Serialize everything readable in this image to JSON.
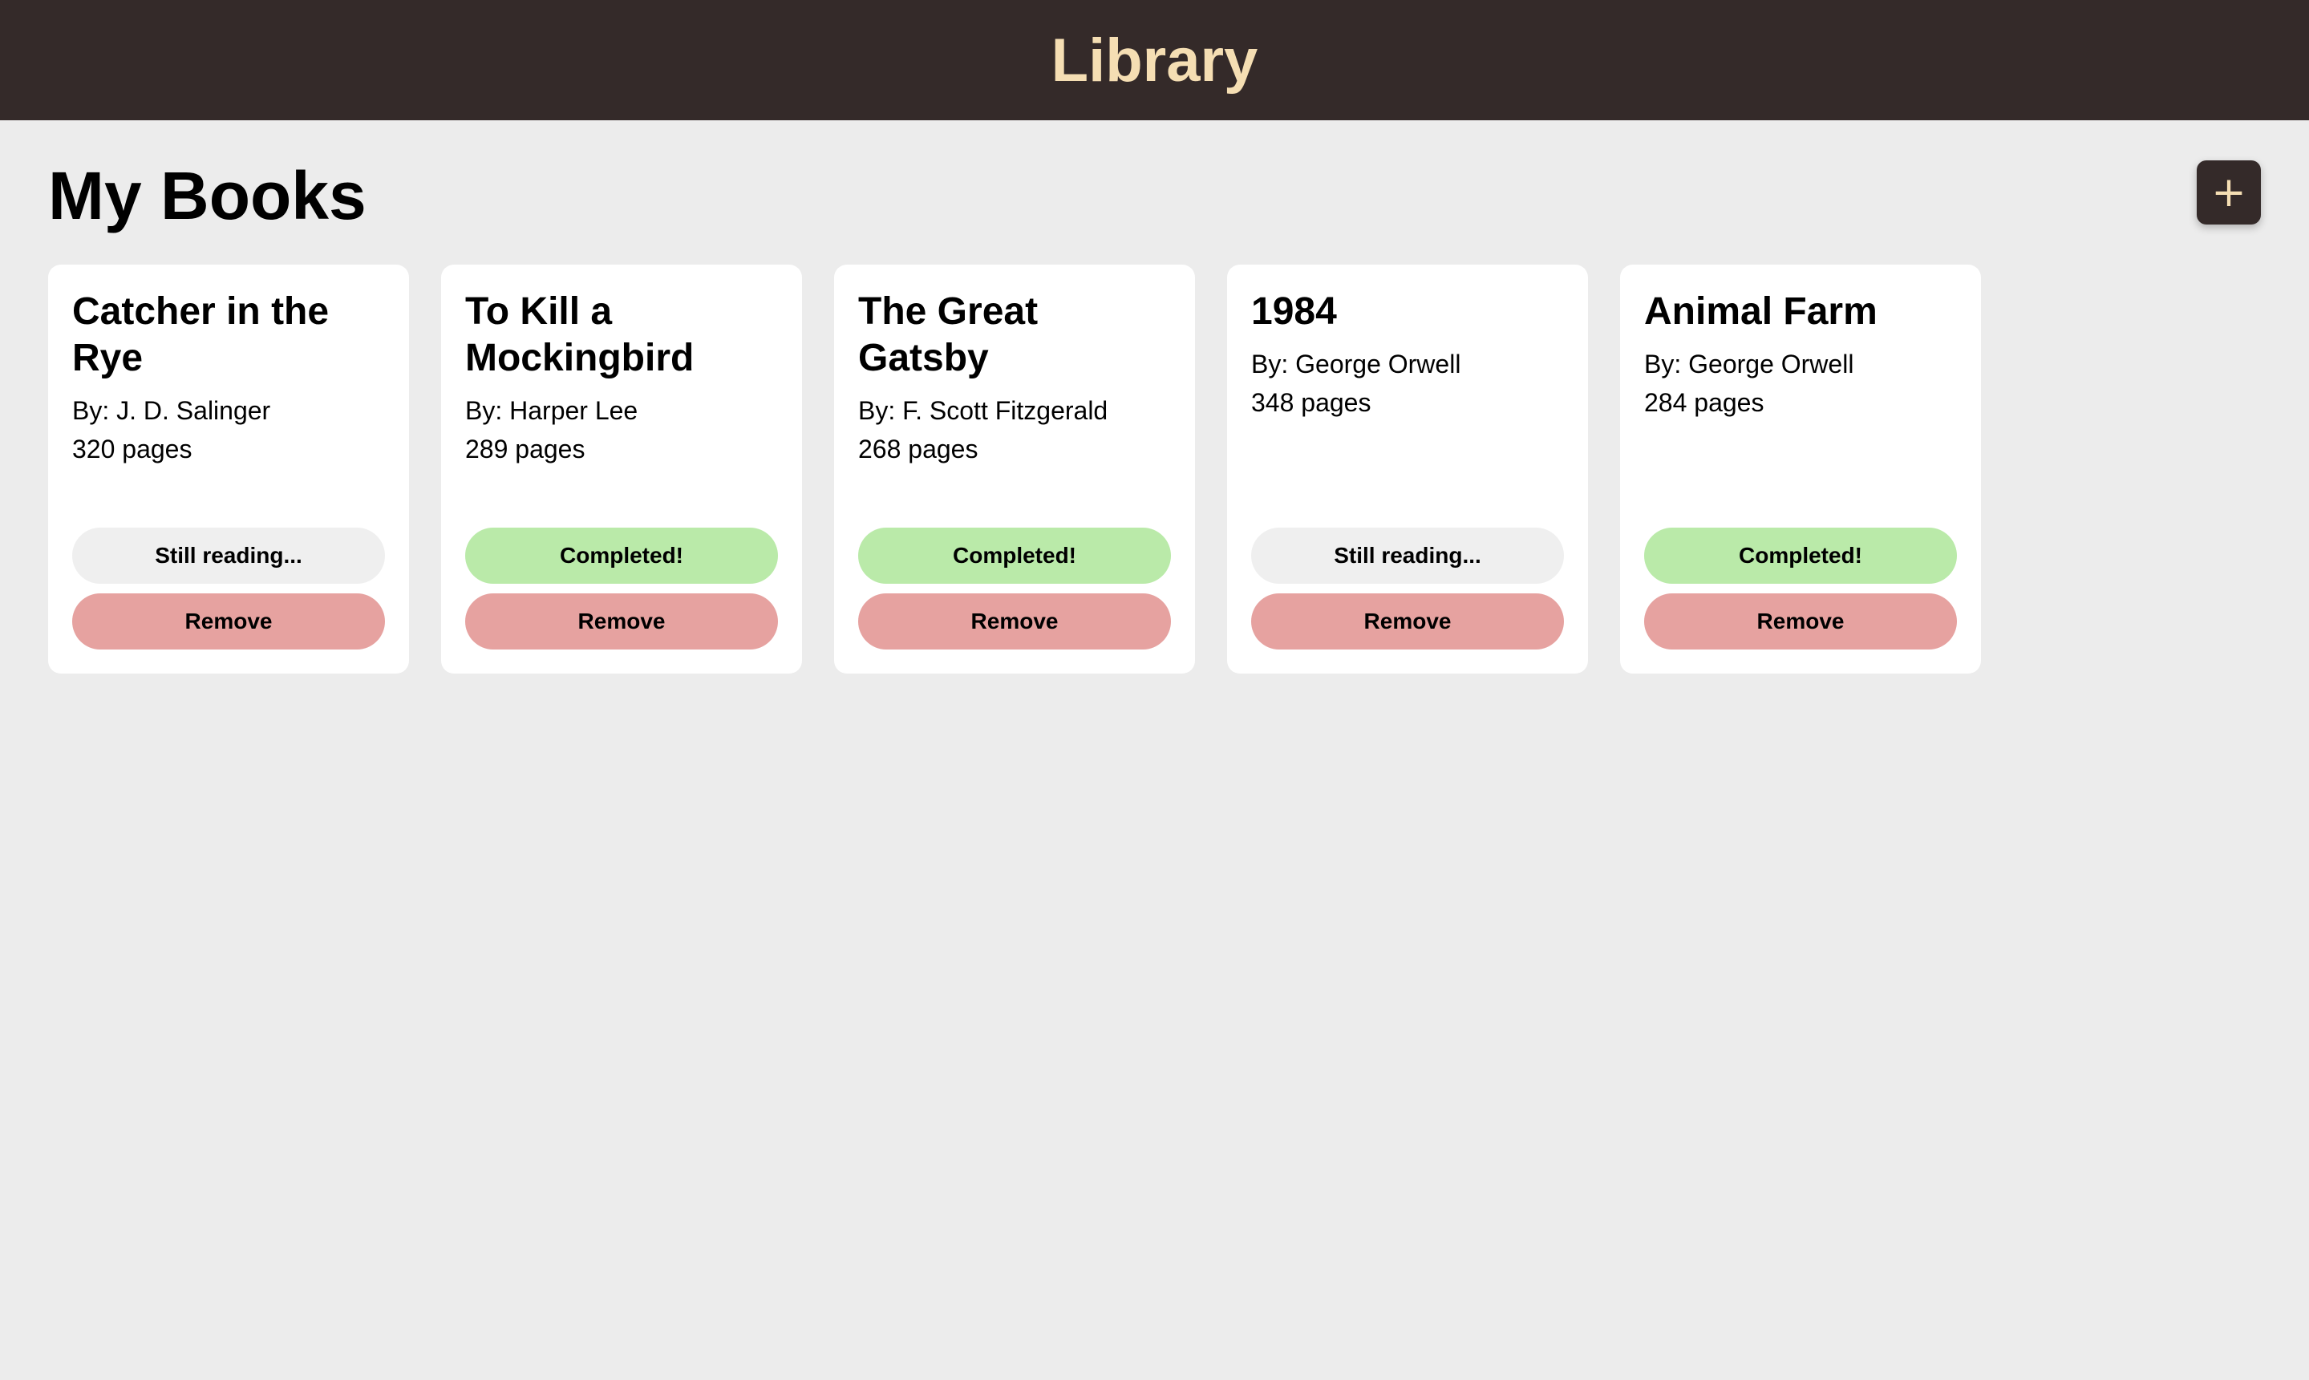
{
  "header": {
    "title": "Library"
  },
  "main": {
    "section_title": "My Books",
    "add_button_label": "+"
  },
  "books": [
    {
      "title": "Catcher in the Rye",
      "author": "By: J. D. Salinger",
      "pages": "320 pages",
      "status": "Still reading...",
      "status_state": "reading",
      "remove_label": "Remove"
    },
    {
      "title": "To Kill a Mockingbird",
      "author": "By: Harper Lee",
      "pages": "289 pages",
      "status": "Completed!",
      "status_state": "completed",
      "remove_label": "Remove"
    },
    {
      "title": "The Great Gatsby",
      "author": "By: F. Scott Fitzgerald",
      "pages": "268 pages",
      "status": "Completed!",
      "status_state": "completed",
      "remove_label": "Remove"
    },
    {
      "title": "1984",
      "author": "By: George Orwell",
      "pages": "348 pages",
      "status": "Still reading...",
      "status_state": "reading",
      "remove_label": "Remove"
    },
    {
      "title": "Animal Farm",
      "author": "By: George Orwell",
      "pages": "284 pages",
      "status": "Completed!",
      "status_state": "completed",
      "remove_label": "Remove"
    }
  ],
  "colors": {
    "header_bg": "#342a29",
    "header_text": "#f5deb3",
    "page_bg": "#ececec",
    "completed": "#baeaa9",
    "reading": "#efefef",
    "remove": "#e6a2a0"
  }
}
